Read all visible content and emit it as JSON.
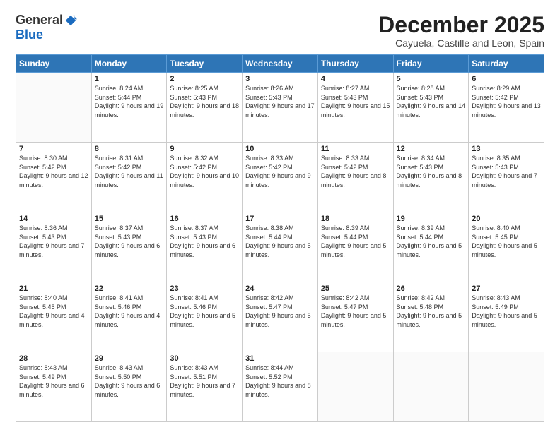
{
  "logo": {
    "general": "General",
    "blue": "Blue"
  },
  "title": "December 2025",
  "location": "Cayuela, Castille and Leon, Spain",
  "weekdays": [
    "Sunday",
    "Monday",
    "Tuesday",
    "Wednesday",
    "Thursday",
    "Friday",
    "Saturday"
  ],
  "weeks": [
    [
      {
        "day": "",
        "sunrise": "",
        "sunset": "",
        "daylight": ""
      },
      {
        "day": "1",
        "sunrise": "Sunrise: 8:24 AM",
        "sunset": "Sunset: 5:44 PM",
        "daylight": "Daylight: 9 hours and 19 minutes."
      },
      {
        "day": "2",
        "sunrise": "Sunrise: 8:25 AM",
        "sunset": "Sunset: 5:43 PM",
        "daylight": "Daylight: 9 hours and 18 minutes."
      },
      {
        "day": "3",
        "sunrise": "Sunrise: 8:26 AM",
        "sunset": "Sunset: 5:43 PM",
        "daylight": "Daylight: 9 hours and 17 minutes."
      },
      {
        "day": "4",
        "sunrise": "Sunrise: 8:27 AM",
        "sunset": "Sunset: 5:43 PM",
        "daylight": "Daylight: 9 hours and 15 minutes."
      },
      {
        "day": "5",
        "sunrise": "Sunrise: 8:28 AM",
        "sunset": "Sunset: 5:43 PM",
        "daylight": "Daylight: 9 hours and 14 minutes."
      },
      {
        "day": "6",
        "sunrise": "Sunrise: 8:29 AM",
        "sunset": "Sunset: 5:42 PM",
        "daylight": "Daylight: 9 hours and 13 minutes."
      }
    ],
    [
      {
        "day": "7",
        "sunrise": "Sunrise: 8:30 AM",
        "sunset": "Sunset: 5:42 PM",
        "daylight": "Daylight: 9 hours and 12 minutes."
      },
      {
        "day": "8",
        "sunrise": "Sunrise: 8:31 AM",
        "sunset": "Sunset: 5:42 PM",
        "daylight": "Daylight: 9 hours and 11 minutes."
      },
      {
        "day": "9",
        "sunrise": "Sunrise: 8:32 AM",
        "sunset": "Sunset: 5:42 PM",
        "daylight": "Daylight: 9 hours and 10 minutes."
      },
      {
        "day": "10",
        "sunrise": "Sunrise: 8:33 AM",
        "sunset": "Sunset: 5:42 PM",
        "daylight": "Daylight: 9 hours and 9 minutes."
      },
      {
        "day": "11",
        "sunrise": "Sunrise: 8:33 AM",
        "sunset": "Sunset: 5:42 PM",
        "daylight": "Daylight: 9 hours and 8 minutes."
      },
      {
        "day": "12",
        "sunrise": "Sunrise: 8:34 AM",
        "sunset": "Sunset: 5:43 PM",
        "daylight": "Daylight: 9 hours and 8 minutes."
      },
      {
        "day": "13",
        "sunrise": "Sunrise: 8:35 AM",
        "sunset": "Sunset: 5:43 PM",
        "daylight": "Daylight: 9 hours and 7 minutes."
      }
    ],
    [
      {
        "day": "14",
        "sunrise": "Sunrise: 8:36 AM",
        "sunset": "Sunset: 5:43 PM",
        "daylight": "Daylight: 9 hours and 7 minutes."
      },
      {
        "day": "15",
        "sunrise": "Sunrise: 8:37 AM",
        "sunset": "Sunset: 5:43 PM",
        "daylight": "Daylight: 9 hours and 6 minutes."
      },
      {
        "day": "16",
        "sunrise": "Sunrise: 8:37 AM",
        "sunset": "Sunset: 5:43 PM",
        "daylight": "Daylight: 9 hours and 6 minutes."
      },
      {
        "day": "17",
        "sunrise": "Sunrise: 8:38 AM",
        "sunset": "Sunset: 5:44 PM",
        "daylight": "Daylight: 9 hours and 5 minutes."
      },
      {
        "day": "18",
        "sunrise": "Sunrise: 8:39 AM",
        "sunset": "Sunset: 5:44 PM",
        "daylight": "Daylight: 9 hours and 5 minutes."
      },
      {
        "day": "19",
        "sunrise": "Sunrise: 8:39 AM",
        "sunset": "Sunset: 5:44 PM",
        "daylight": "Daylight: 9 hours and 5 minutes."
      },
      {
        "day": "20",
        "sunrise": "Sunrise: 8:40 AM",
        "sunset": "Sunset: 5:45 PM",
        "daylight": "Daylight: 9 hours and 5 minutes."
      }
    ],
    [
      {
        "day": "21",
        "sunrise": "Sunrise: 8:40 AM",
        "sunset": "Sunset: 5:45 PM",
        "daylight": "Daylight: 9 hours and 4 minutes."
      },
      {
        "day": "22",
        "sunrise": "Sunrise: 8:41 AM",
        "sunset": "Sunset: 5:46 PM",
        "daylight": "Daylight: 9 hours and 4 minutes."
      },
      {
        "day": "23",
        "sunrise": "Sunrise: 8:41 AM",
        "sunset": "Sunset: 5:46 PM",
        "daylight": "Daylight: 9 hours and 5 minutes."
      },
      {
        "day": "24",
        "sunrise": "Sunrise: 8:42 AM",
        "sunset": "Sunset: 5:47 PM",
        "daylight": "Daylight: 9 hours and 5 minutes."
      },
      {
        "day": "25",
        "sunrise": "Sunrise: 8:42 AM",
        "sunset": "Sunset: 5:47 PM",
        "daylight": "Daylight: 9 hours and 5 minutes."
      },
      {
        "day": "26",
        "sunrise": "Sunrise: 8:42 AM",
        "sunset": "Sunset: 5:48 PM",
        "daylight": "Daylight: 9 hours and 5 minutes."
      },
      {
        "day": "27",
        "sunrise": "Sunrise: 8:43 AM",
        "sunset": "Sunset: 5:49 PM",
        "daylight": "Daylight: 9 hours and 5 minutes."
      }
    ],
    [
      {
        "day": "28",
        "sunrise": "Sunrise: 8:43 AM",
        "sunset": "Sunset: 5:49 PM",
        "daylight": "Daylight: 9 hours and 6 minutes."
      },
      {
        "day": "29",
        "sunrise": "Sunrise: 8:43 AM",
        "sunset": "Sunset: 5:50 PM",
        "daylight": "Daylight: 9 hours and 6 minutes."
      },
      {
        "day": "30",
        "sunrise": "Sunrise: 8:43 AM",
        "sunset": "Sunset: 5:51 PM",
        "daylight": "Daylight: 9 hours and 7 minutes."
      },
      {
        "day": "31",
        "sunrise": "Sunrise: 8:44 AM",
        "sunset": "Sunset: 5:52 PM",
        "daylight": "Daylight: 9 hours and 8 minutes."
      },
      {
        "day": "",
        "sunrise": "",
        "sunset": "",
        "daylight": ""
      },
      {
        "day": "",
        "sunrise": "",
        "sunset": "",
        "daylight": ""
      },
      {
        "day": "",
        "sunrise": "",
        "sunset": "",
        "daylight": ""
      }
    ]
  ]
}
